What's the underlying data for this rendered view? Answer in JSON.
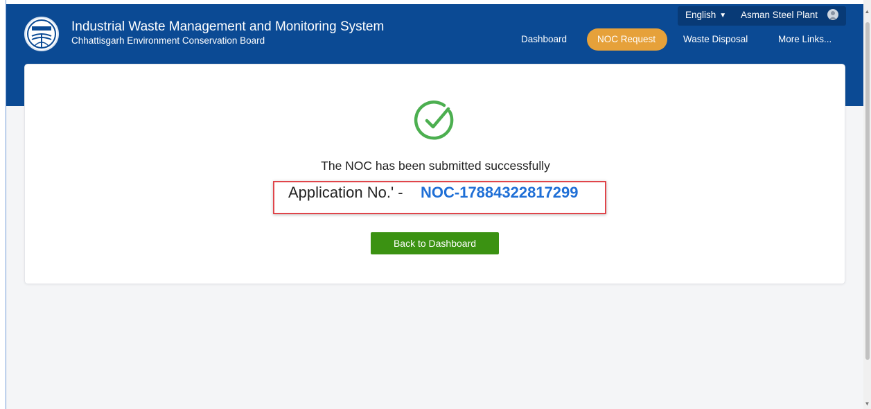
{
  "header": {
    "title": "Industrial Waste Management and Monitoring System",
    "subtitle": "Chhattisgarh Environment Conservation Board",
    "language": "English",
    "user": "Asman Steel Plant",
    "nav": {
      "dashboard": "Dashboard",
      "noc_request": "NOC Request",
      "waste_disposal": "Waste Disposal",
      "more_links": "More Links..."
    },
    "active_nav": "NOC Request"
  },
  "confirmation": {
    "message": "The NOC has been submitted successfully",
    "application_label": "Application No.' -",
    "application_number": "NOC-17884322817299",
    "back_button": "Back to Dashboard"
  },
  "colors": {
    "header_bg": "#0b4a94",
    "active_pill": "#e6a13a",
    "success_green": "#4caf50",
    "button_green": "#3b9212",
    "link_blue": "#1f6fd6",
    "highlight_red": "#e0454a"
  },
  "icons": {
    "logo": "board-emblem-icon",
    "check": "check-circle-icon",
    "dropdown": "chevron-down-icon",
    "user": "user-avatar-icon"
  }
}
